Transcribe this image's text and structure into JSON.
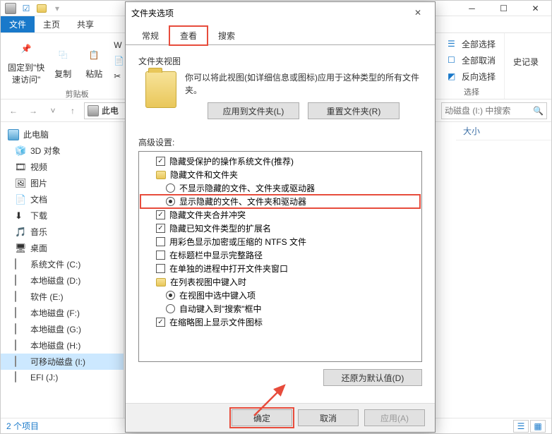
{
  "explorer": {
    "tabs": {
      "file": "文件",
      "home": "主页",
      "share": "共享"
    },
    "ribbon": {
      "pin": "固定到\"快\n速访问\"",
      "copy": "复制",
      "paste": "粘贴",
      "cut": "剪切",
      "clipboard_group": "剪贴板",
      "select_all": "全部选择",
      "select_none": "全部取消",
      "invert": "反向选择",
      "select_group": "选择",
      "history": "史记录"
    },
    "address": "此电",
    "search_placeholder": "动磁盘 (I:) 中搜索",
    "columns": {
      "size": "大小"
    },
    "tree": {
      "root": "此电脑",
      "items": [
        {
          "label": "3D 对象",
          "icon": "3d"
        },
        {
          "label": "视频",
          "icon": "video"
        },
        {
          "label": "图片",
          "icon": "picture"
        },
        {
          "label": "文档",
          "icon": "doc"
        },
        {
          "label": "下载",
          "icon": "download"
        },
        {
          "label": "音乐",
          "icon": "music"
        },
        {
          "label": "桌面",
          "icon": "desktop"
        },
        {
          "label": "系统文件 (C:)",
          "icon": "drive"
        },
        {
          "label": "本地磁盘 (D:)",
          "icon": "drive"
        },
        {
          "label": "软件 (E:)",
          "icon": "drive"
        },
        {
          "label": "本地磁盘 (F:)",
          "icon": "drive"
        },
        {
          "label": "本地磁盘 (G:)",
          "icon": "drive"
        },
        {
          "label": "本地磁盘 (H:)",
          "icon": "drive"
        },
        {
          "label": "可移动磁盘 (I:)",
          "icon": "drive",
          "selected": true
        },
        {
          "label": "EFI (J:)",
          "icon": "drive"
        }
      ]
    },
    "status": "2 个项目"
  },
  "dialog": {
    "title": "文件夹选项",
    "tabs": {
      "general": "常规",
      "view": "查看",
      "search": "搜索"
    },
    "folder_view": {
      "title": "文件夹视图",
      "desc": "你可以将此视图(如详细信息或图标)应用于这种类型的所有文件夹。",
      "apply_btn": "应用到文件夹(L)",
      "reset_btn": "重置文件夹(R)"
    },
    "advanced_label": "高级设置:",
    "advanced": [
      {
        "type": "check",
        "checked": true,
        "indent": 1,
        "label": "隐藏受保护的操作系统文件(推荐)"
      },
      {
        "type": "folder",
        "indent": 1,
        "label": "隐藏文件和文件夹"
      },
      {
        "type": "radio",
        "checked": false,
        "indent": 2,
        "label": "不显示隐藏的文件、文件夹或驱动器"
      },
      {
        "type": "radio",
        "checked": true,
        "indent": 2,
        "label": "显示隐藏的文件、文件夹和驱动器",
        "highlight": true
      },
      {
        "type": "check",
        "checked": true,
        "indent": 1,
        "label": "隐藏文件夹合并冲突"
      },
      {
        "type": "check",
        "checked": true,
        "indent": 1,
        "label": "隐藏已知文件类型的扩展名"
      },
      {
        "type": "check",
        "checked": false,
        "indent": 1,
        "label": "用彩色显示加密或压缩的 NTFS 文件"
      },
      {
        "type": "check",
        "checked": false,
        "indent": 1,
        "label": "在标题栏中显示完整路径"
      },
      {
        "type": "check",
        "checked": false,
        "indent": 1,
        "label": "在单独的进程中打开文件夹窗口"
      },
      {
        "type": "folder",
        "indent": 1,
        "label": "在列表视图中键入时"
      },
      {
        "type": "radio",
        "checked": true,
        "indent": 2,
        "label": "在视图中选中键入项"
      },
      {
        "type": "radio",
        "checked": false,
        "indent": 2,
        "label": "自动键入到\"搜索\"框中"
      },
      {
        "type": "check",
        "checked": true,
        "indent": 1,
        "label": "在缩略图上显示文件图标"
      }
    ],
    "restore_btn": "还原为默认值(D)",
    "ok": "确定",
    "cancel": "取消",
    "apply": "应用(A)"
  }
}
